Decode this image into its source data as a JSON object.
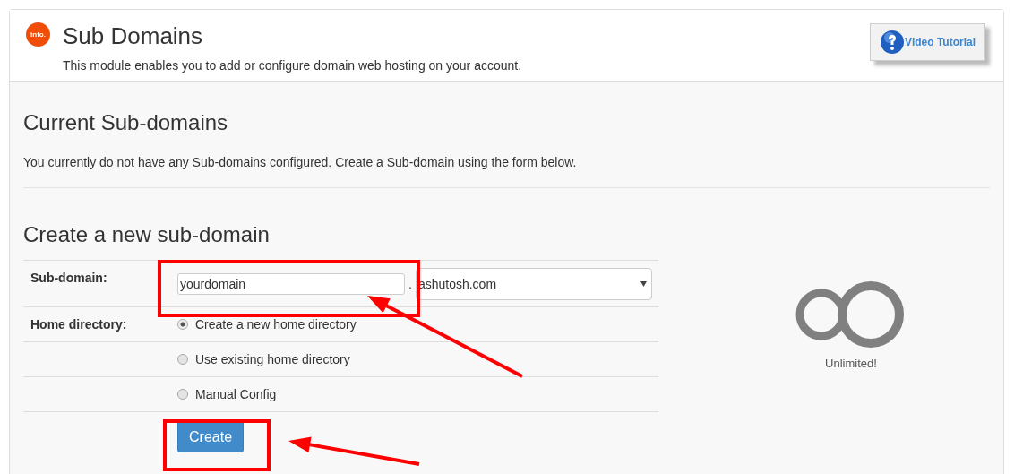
{
  "header": {
    "badge": "info.",
    "title": "Sub Domains",
    "description": "This module enables you to add or configure domain web hosting on your account.",
    "tutorial_button": "Video Tutorial"
  },
  "current": {
    "heading": "Current Sub-domains",
    "message": "You currently do not have any Sub-domains configured. Create a Sub-domain using the form below."
  },
  "create": {
    "heading": "Create a new sub-domain",
    "subdomain": {
      "label": "Sub-domain:",
      "value": "yourdomain",
      "separator": ".",
      "domain": "ashutosh.com"
    },
    "home_directory": {
      "label": "Home directory:",
      "options": [
        {
          "label": "Create a new home directory",
          "selected": true
        },
        {
          "label": "Use existing home directory",
          "selected": false
        },
        {
          "label": "Manual Config",
          "selected": false
        }
      ]
    },
    "submit": "Create"
  },
  "quota": {
    "label": "Unlimited!"
  }
}
